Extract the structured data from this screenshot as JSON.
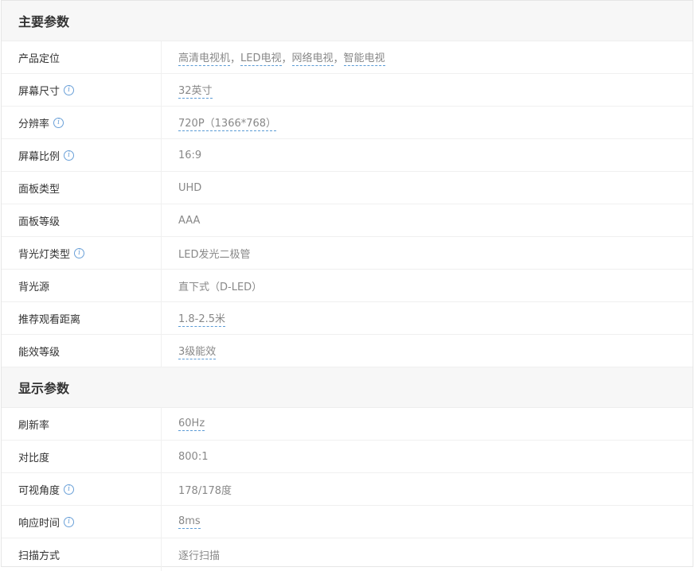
{
  "sections": [
    {
      "title": "主要参数",
      "rows": [
        {
          "key": "产品定位",
          "values": [
            "高清电视机",
            "LED电视",
            "网络电视",
            "智能电视"
          ],
          "separator": "，",
          "link": true
        },
        {
          "key": "屏幕尺寸",
          "info": true,
          "values": [
            "32英寸"
          ],
          "link": true
        },
        {
          "key": "分辨率",
          "info": true,
          "values": [
            "720P（1366*768）"
          ],
          "link": true
        },
        {
          "key": "屏幕比例",
          "info": true,
          "values": [
            "16:9"
          ],
          "link": false
        },
        {
          "key": "面板类型",
          "values": [
            "UHD"
          ],
          "link": false
        },
        {
          "key": "面板等级",
          "values": [
            "AAA"
          ],
          "link": false
        },
        {
          "key": "背光灯类型",
          "info": true,
          "values": [
            "LED发光二极管"
          ],
          "link": false
        },
        {
          "key": "背光源",
          "values": [
            "直下式（D-LED）"
          ],
          "link": false
        },
        {
          "key": "推荐观看距离",
          "values": [
            "1.8-2.5米"
          ],
          "link": true
        },
        {
          "key": "能效等级",
          "values": [
            "3级能效"
          ],
          "link": true
        }
      ]
    },
    {
      "title": "显示参数",
      "rows": [
        {
          "key": "刷新率",
          "values": [
            "60Hz"
          ],
          "link": true
        },
        {
          "key": "对比度",
          "values": [
            "800:1"
          ],
          "link": false
        },
        {
          "key": "可视角度",
          "info": true,
          "values": [
            "178/178度"
          ],
          "link": false
        },
        {
          "key": "响应时间",
          "info": true,
          "values": [
            "8ms"
          ],
          "link": true
        },
        {
          "key": "扫描方式",
          "values": [
            "逐行扫描"
          ],
          "link": false
        }
      ]
    }
  ],
  "info_icon_glyph": "i",
  "colors": {
    "link_underline": "#5b9bd5",
    "info_icon": "#6aa0d8"
  }
}
